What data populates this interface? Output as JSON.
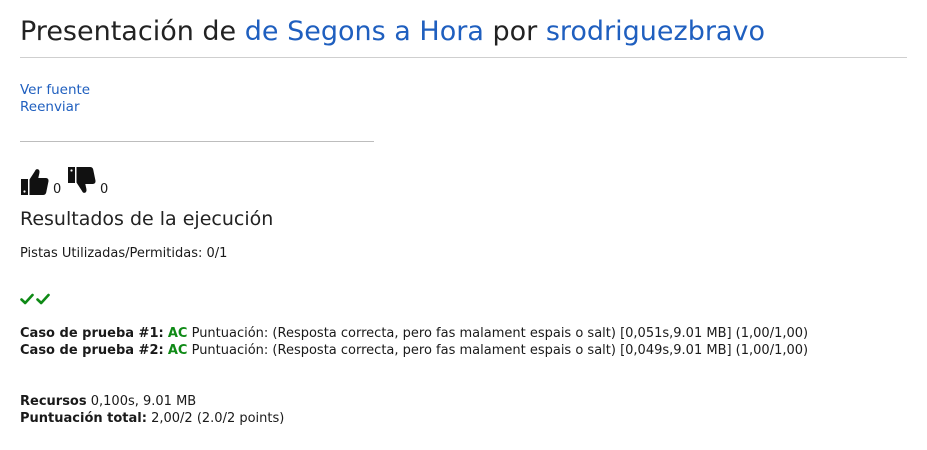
{
  "header": {
    "prefix": "Presentación de",
    "problem_link": "de Segons a Hora",
    "middle": "por",
    "user_link": "srodriguezbravo"
  },
  "actions": {
    "view_source": "Ver fuente",
    "resubmit": "Reenviar"
  },
  "votes": {
    "up_icon": "thumbs-up-icon",
    "up_count": "0",
    "down_icon": "thumbs-down-icon",
    "down_count": "0"
  },
  "results": {
    "heading": "Resultados de la ejecución",
    "hints": "Pistas Utilizadas/Permitidas: 0/1",
    "check_icon": "check-icon",
    "status_color": "#0f8a16",
    "cases": [
      {
        "label": "Caso de prueba #1:",
        "status": "AC",
        "detail": "Puntuación: (Resposta correcta, pero fas malament espais o salt) [0,051s,9.01 MB] (1,00/1,00)"
      },
      {
        "label": "Caso de prueba #2:",
        "status": "AC",
        "detail": "Puntuación: (Resposta correcta, pero fas malament espais o salt) [0,049s,9.01 MB] (1,00/1,00)"
      }
    ],
    "resources_label": "Recursos",
    "resources_value": "0,100s, 9.01 MB",
    "total_label": "Puntuación total:",
    "total_value": "2,00/2 (2.0/2 points)"
  },
  "colors": {
    "link": "#1f5fbf",
    "accepted": "#0f8a16"
  }
}
